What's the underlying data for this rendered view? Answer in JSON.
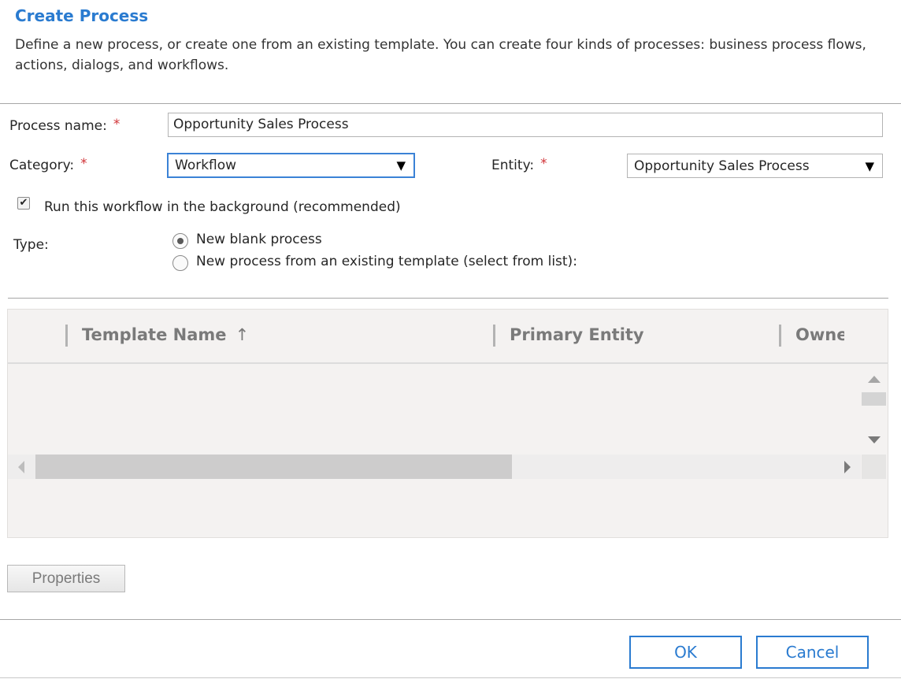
{
  "dialog": {
    "title": "Create Process",
    "description": "Define a new process, or create one from an existing template. You can create four kinds of processes: business process flows, actions, dialogs, and workflows."
  },
  "form": {
    "process_name_label": "Process name:",
    "process_name_value": "Opportunity Sales Process",
    "category_label": "Category:",
    "category_value": "Workflow",
    "entity_label": "Entity:",
    "entity_value": "Opportunity Sales Process",
    "required_mark": "*",
    "run_background_label": "Run this workflow in the background (recommended)",
    "run_background_checked": true,
    "type_label": "Type:",
    "type_options": [
      {
        "label": "New blank process",
        "selected": true
      },
      {
        "label": "New process from an existing template (select from list):",
        "selected": false
      }
    ]
  },
  "grid": {
    "columns": [
      "Template Name",
      "Primary Entity",
      "Owne"
    ],
    "sort_icon": "arrow-up-icon"
  },
  "buttons": {
    "properties": "Properties",
    "ok": "OK",
    "cancel": "Cancel"
  },
  "colors": {
    "accent": "#2a7bd0",
    "required": "#d13438"
  }
}
